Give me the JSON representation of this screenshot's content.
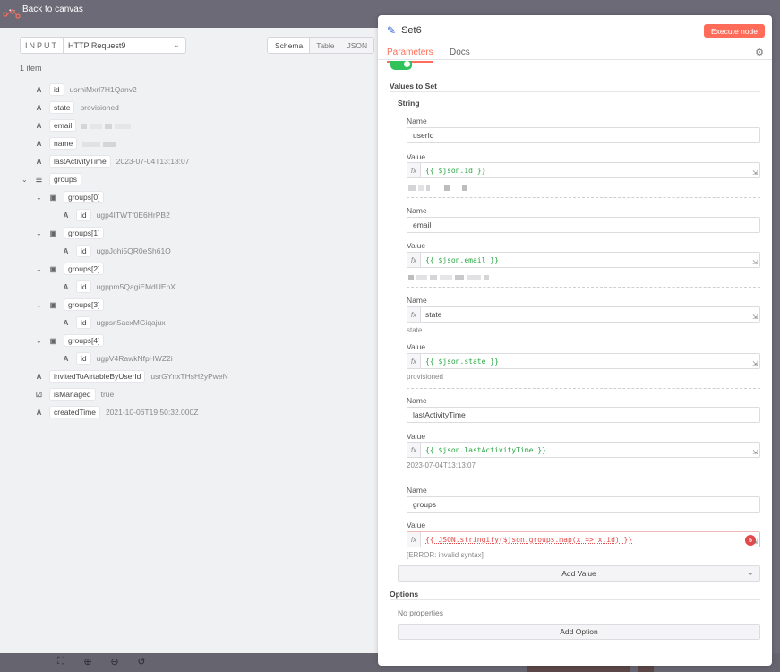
{
  "topbar": {
    "back_label": "Back to canvas"
  },
  "left": {
    "input_label": "INPUT",
    "node_select": "HTTP Request9",
    "tabs": [
      "Schema",
      "Table",
      "JSON"
    ],
    "active_tab": "Schema",
    "item_count": "1 item",
    "fields": {
      "id": {
        "key": "id",
        "value": "usrniMxrl7H1Qanv2"
      },
      "state": {
        "key": "state",
        "value": "provisioned"
      },
      "email": {
        "key": "email"
      },
      "name": {
        "key": "name"
      },
      "lastActivityTime": {
        "key": "lastActivityTime",
        "value": "2023-07-04T13:13:07"
      },
      "groups": {
        "key": "groups"
      },
      "group_items": [
        {
          "key": "groups[0]",
          "id_key": "id",
          "id_value": "ugp4ITWTf0E6HrPB2"
        },
        {
          "key": "groups[1]",
          "id_key": "id",
          "id_value": "ugpJohi5QR0eSh61O"
        },
        {
          "key": "groups[2]",
          "id_key": "id",
          "id_value": "ugppm5QagiEMdUEhX"
        },
        {
          "key": "groups[3]",
          "id_key": "id",
          "id_value": "ugpsn5acxMGiqajux"
        },
        {
          "key": "groups[4]",
          "id_key": "id",
          "id_value": "ugpV4RawkNfpHWZ2i"
        }
      ],
      "invitedToAirtableByUserId": {
        "key": "invitedToAirtableByUserId",
        "value": "usrGYnxTHsH2yPweN"
      },
      "isManaged": {
        "key": "isManaged",
        "value": "true"
      },
      "createdTime": {
        "key": "createdTime",
        "value": "2021-10-06T19:50:32.000Z"
      }
    }
  },
  "panel": {
    "title": "Set6",
    "execute_label": "Execute node",
    "tab_parameters": "Parameters",
    "tab_docs": "Docs",
    "values_to_set": "Values to Set",
    "string_label": "String",
    "name_label": "Name",
    "value_label": "Value",
    "fx_label": "fx",
    "entries": [
      {
        "name": "userId",
        "expr": "{{ $json.id }}",
        "hint": ""
      },
      {
        "name": "email",
        "expr": "{{ $json.email }}",
        "hint": ""
      },
      {
        "name": "state",
        "expr": "{{ $json.state }}",
        "hint": "provisioned",
        "name_hint": "state"
      },
      {
        "name": "lastActivityTime",
        "expr": "{{ $json.lastActivityTime }}",
        "hint": "2023-07-04T13:13:07"
      },
      {
        "name": "groups",
        "expr": "{{ JSON.stringify($json.groups.map(x => x.id) }}",
        "hint": "[ERROR: invalid syntax]",
        "error_count": "5"
      }
    ],
    "add_value": "Add Value",
    "options_label": "Options",
    "no_properties": "No properties",
    "add_option": "Add Option"
  },
  "colors": {
    "accent": "#ff6d5a",
    "toggle_on": "#2fc35a",
    "expr_green": "#29a844",
    "error_red": "#e44848"
  }
}
